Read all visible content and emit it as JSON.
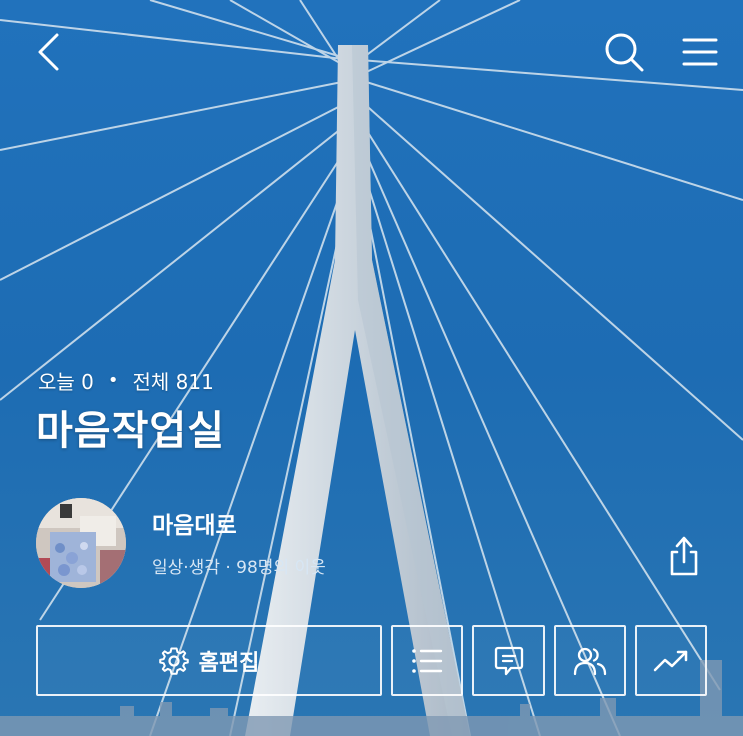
{
  "header": {
    "back_icon": "chevron-left-icon",
    "search_icon": "search-icon",
    "menu_icon": "hamburger-menu-icon"
  },
  "visitors": {
    "today_label": "오늘 0",
    "separator": "•",
    "total_label": "전체 811"
  },
  "blog": {
    "title": "마음작업실"
  },
  "profile": {
    "nickname": "마음대로",
    "meta": "일상·생각 · 98명의 이웃",
    "avatar_icon": "avatar"
  },
  "actions": {
    "share_icon": "share-icon",
    "edit_label": "홈편집",
    "edit_icon": "gear-icon",
    "list_icon": "list-icon",
    "comment_icon": "comment-icon",
    "neighbor_icon": "people-icon",
    "stats_icon": "trend-chart-icon"
  },
  "colors": {
    "sky": "#1f6fb8",
    "text": "#ffffff",
    "meta_text": "#d7e6f4"
  }
}
